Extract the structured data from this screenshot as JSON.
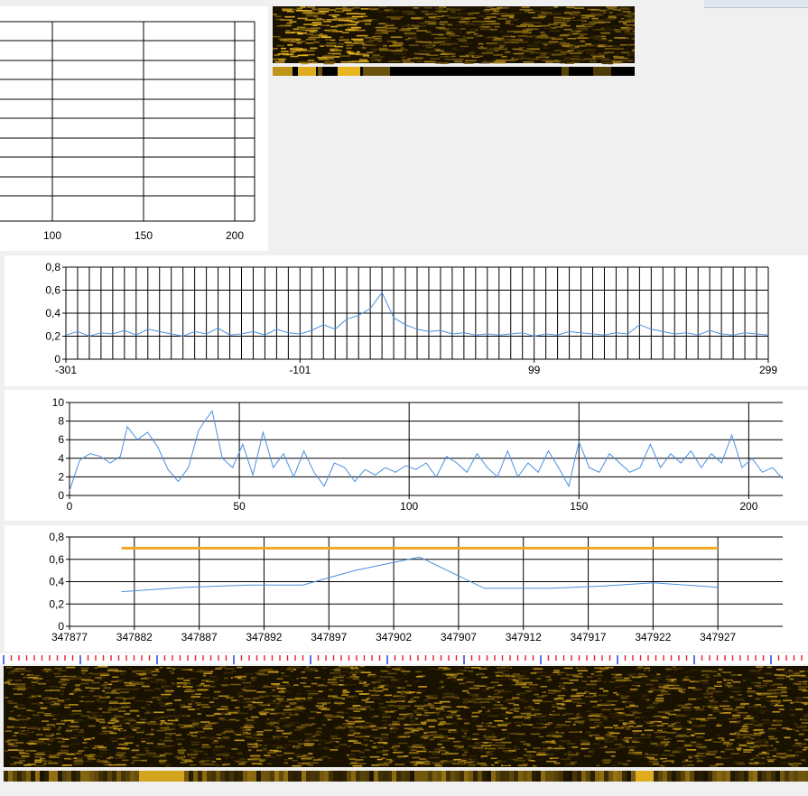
{
  "colors": {
    "series_line": "#4a8fe0",
    "threshold_line": "#f5a623",
    "grid": "#000000",
    "waterfall_dark": "#1a1200",
    "waterfall_bright": "#e8b420",
    "ruler_red": "#e8202a",
    "ruler_blue": "#2030e0"
  },
  "icons": {
    "window_buttons": "window-controls-icon"
  },
  "chart_data": [
    {
      "id": "top-left-chart",
      "type": "line",
      "title": "",
      "xlabel": "",
      "ylabel": "",
      "x_ticks": [
        "100",
        "150",
        "200"
      ],
      "series": []
    },
    {
      "id": "correlation-chart",
      "type": "line",
      "title": "",
      "xlabel": "",
      "ylabel": "",
      "xlim": [
        -301,
        299
      ],
      "ylim": [
        0,
        0.8
      ],
      "x_ticks": [
        "-301",
        "-101",
        "99",
        "299"
      ],
      "y_ticks": [
        "0",
        "0,2",
        "0,4",
        "0,6",
        "0,8"
      ],
      "series": [
        {
          "x": [
            -301,
            -291,
            -281,
            -271,
            -261,
            -251,
            -241,
            -231,
            -221,
            -211,
            -201,
            -191,
            -181,
            -171,
            -161,
            -151,
            -141,
            -131,
            -121,
            -111,
            -101,
            -91,
            -81,
            -71,
            -61,
            -51,
            -41,
            -31,
            -21,
            -11,
            -1,
            9,
            19,
            29,
            39,
            49,
            59,
            69,
            79,
            89,
            99,
            109,
            119,
            129,
            139,
            149,
            159,
            169,
            179,
            189,
            199,
            209,
            219,
            229,
            239,
            249,
            259,
            269,
            279,
            289,
            299
          ],
          "y": [
            0.21,
            0.24,
            0.2,
            0.23,
            0.22,
            0.25,
            0.21,
            0.26,
            0.24,
            0.22,
            0.2,
            0.24,
            0.22,
            0.27,
            0.21,
            0.22,
            0.24,
            0.21,
            0.26,
            0.23,
            0.22,
            0.25,
            0.3,
            0.26,
            0.35,
            0.38,
            0.44,
            0.58,
            0.36,
            0.3,
            0.26,
            0.24,
            0.25,
            0.22,
            0.23,
            0.21,
            0.22,
            0.21,
            0.22,
            0.23,
            0.2,
            0.22,
            0.21,
            0.24,
            0.23,
            0.22,
            0.21,
            0.23,
            0.22,
            0.3,
            0.26,
            0.24,
            0.22,
            0.23,
            0.21,
            0.25,
            0.22,
            0.21,
            0.23,
            0.22,
            0.21
          ]
        }
      ]
    },
    {
      "id": "signal-chart",
      "type": "line",
      "title": "",
      "xlabel": "",
      "ylabel": "",
      "xlim": [
        0,
        210
      ],
      "ylim": [
        0,
        10
      ],
      "x_ticks": [
        "0",
        "50",
        "100",
        "150",
        "200"
      ],
      "y_ticks": [
        "0",
        "2",
        "4",
        "6",
        "8",
        "10"
      ],
      "series": [
        {
          "x": [
            0,
            3,
            6,
            9,
            12,
            15,
            17,
            20,
            23,
            26,
            29,
            32,
            35,
            38,
            40,
            42,
            45,
            48,
            51,
            54,
            57,
            60,
            63,
            66,
            69,
            72,
            75,
            78,
            81,
            84,
            87,
            90,
            93,
            96,
            99,
            102,
            105,
            108,
            111,
            114,
            117,
            120,
            123,
            126,
            129,
            132,
            135,
            138,
            141,
            144,
            147,
            150,
            153,
            156,
            159,
            162,
            165,
            168,
            171,
            174,
            177,
            180,
            183,
            186,
            189,
            192,
            195,
            198,
            201,
            204,
            207,
            210
          ],
          "y": [
            0.5,
            3.8,
            4.5,
            4.2,
            3.5,
            4.2,
            7.4,
            6.0,
            6.8,
            5.2,
            2.8,
            1.5,
            3.0,
            7.0,
            8.1,
            9.1,
            4.0,
            3.0,
            5.5,
            2.2,
            6.8,
            3.0,
            4.5,
            2.0,
            4.8,
            2.5,
            1.0,
            3.5,
            3.0,
            1.5,
            2.8,
            2.2,
            3.0,
            2.5,
            3.2,
            2.8,
            3.5,
            2.0,
            4.2,
            3.5,
            2.5,
            4.5,
            3.0,
            2.0,
            4.8,
            2.0,
            3.5,
            2.5,
            4.8,
            3.0,
            1.0,
            5.8,
            3.0,
            2.5,
            4.5,
            3.5,
            2.5,
            3.0,
            5.5,
            3.0,
            4.5,
            3.5,
            4.8,
            3.0,
            4.5,
            3.5,
            6.5,
            3.0,
            4.0,
            2.5,
            3.0,
            1.8
          ]
        }
      ]
    },
    {
      "id": "tracking-chart",
      "type": "line",
      "title": "",
      "xlabel": "",
      "ylabel": "",
      "xlim": [
        347877,
        347932
      ],
      "ylim": [
        0,
        0.8
      ],
      "x_ticks": [
        "347877",
        "347882",
        "347887",
        "347892",
        "347897",
        "347902",
        "347907",
        "347912",
        "347917",
        "347922",
        "347927"
      ],
      "y_ticks": [
        "0",
        "0,2",
        "0,4",
        "0,6",
        "0,8"
      ],
      "series": [
        {
          "x": [
            347881,
            347886,
            347891,
            347895,
            347899,
            347904,
            347909,
            347914,
            347918,
            347922,
            347927
          ],
          "y": [
            0.31,
            0.35,
            0.37,
            0.37,
            0.5,
            0.62,
            0.34,
            0.34,
            0.36,
            0.39,
            0.35
          ]
        },
        {
          "x": [
            347881,
            347927
          ],
          "y": [
            0.7,
            0.7
          ]
        }
      ]
    }
  ]
}
